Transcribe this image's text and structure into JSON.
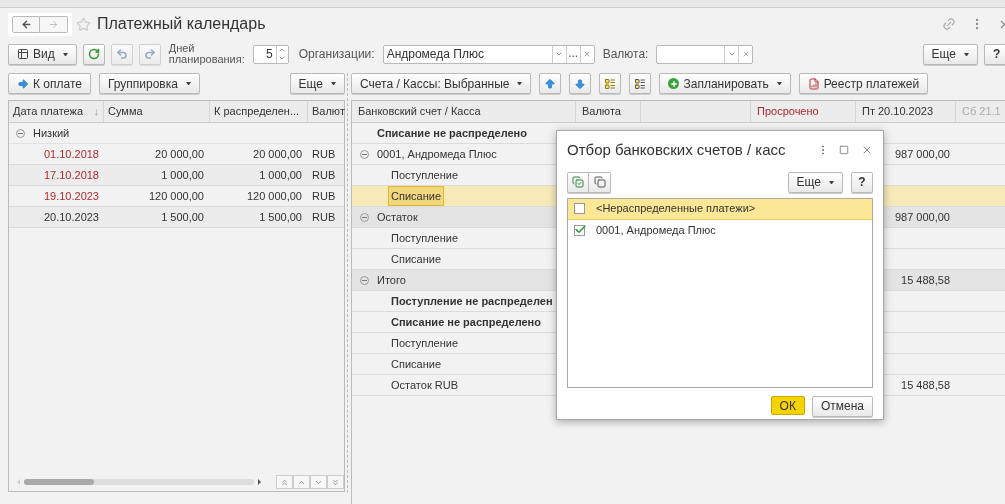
{
  "window": {
    "title": "Платежный календарь"
  },
  "toolbar": {
    "view_button": "Вид",
    "days_label": "Дней планирования:",
    "days_value": "5",
    "org_label": "Организации:",
    "org_value": "Андромеда Плюс",
    "org_more": "...",
    "currency_label": "Валюта:",
    "more_button": "Еще",
    "help_button": "?"
  },
  "left_toolbar": {
    "pay_button": "К оплате",
    "group_button": "Группировка",
    "more_button": "Еще"
  },
  "right_toolbar": {
    "accounts_button": "Счета / Кассы: Выбранные",
    "plan_button": "Запланировать",
    "registry_button": "Реестр платежей"
  },
  "payments_table": {
    "columns": [
      "Дата платежа",
      "Сумма",
      "К распределен...",
      "Валют"
    ],
    "sort_mark": "↓",
    "groups": [
      {
        "label": "Низкий",
        "expanded": true,
        "children": [
          {
            "date": "01.10.2018",
            "sum": "20 000,00",
            "to_distribute": "20 000,00",
            "currency": "RUB",
            "overdue": true
          },
          {
            "date": "17.10.2018",
            "sum": "1 000,00",
            "to_distribute": "1 000,00",
            "currency": "RUB",
            "overdue": true
          },
          {
            "date": "19.10.2023",
            "sum": "120 000,00",
            "to_distribute": "120 000,00",
            "currency": "RUB",
            "overdue": true
          },
          {
            "date": "20.10.2023",
            "sum": "1 500,00",
            "to_distribute": "1 500,00",
            "currency": "RUB",
            "overdue": false
          }
        ]
      }
    ]
  },
  "accounts_table": {
    "columns": [
      {
        "label": "Банковский счет / Касса",
        "kind": "normal"
      },
      {
        "label": "Валюта",
        "kind": "normal"
      },
      {
        "kind": "blank"
      },
      {
        "label": "Просрочено",
        "kind": "overdue"
      },
      {
        "label": "Пт 20.10.2023",
        "kind": "normal"
      },
      {
        "label": "Сб 21.1",
        "kind": "dim"
      }
    ],
    "rows": [
      {
        "kind": "bold",
        "label": "Списание не распределено",
        "selected": false
      },
      {
        "kind": "group",
        "label": "0001, Андромеда Плюс",
        "expanded": true,
        "day_1": "987 000,00",
        "selected": false,
        "children": [
          {
            "kind": "item",
            "label": "Поступление",
            "selected": false
          },
          {
            "kind": "item",
            "label": "Списание",
            "selected": true
          }
        ]
      },
      {
        "kind": "total",
        "label": "Остаток",
        "expanded": true,
        "day_1": "987 000,00",
        "selected": false,
        "children": [
          {
            "kind": "item",
            "label": "Поступление",
            "selected": false
          },
          {
            "kind": "item",
            "label": "Списание",
            "selected": false
          }
        ]
      },
      {
        "kind": "total",
        "label": "Итого",
        "expanded": true,
        "day_1": "15 488,58",
        "selected": false,
        "children": [
          {
            "kind": "bold",
            "label": "Поступление не распределен",
            "selected": false
          },
          {
            "kind": "bold",
            "label": "Списание не распределено",
            "selected": false
          },
          {
            "kind": "item",
            "label": "Поступление",
            "selected": false
          },
          {
            "kind": "item",
            "label": "Списание",
            "selected": false
          },
          {
            "kind": "item",
            "label": "Остаток RUB",
            "day_1": "15 488,58",
            "selected": false
          }
        ]
      }
    ]
  },
  "dialog": {
    "title": "Отбор банковских счетов / касс",
    "more_button": "Еще",
    "help_button": "?",
    "items": [
      {
        "label": "<Нераспределенные платежи>",
        "checked": false,
        "selected": true
      },
      {
        "label": "0001, Андромеда Плюс",
        "checked": true,
        "selected": false
      }
    ],
    "ok_button": "ОК",
    "cancel_button": "Отмена"
  }
}
